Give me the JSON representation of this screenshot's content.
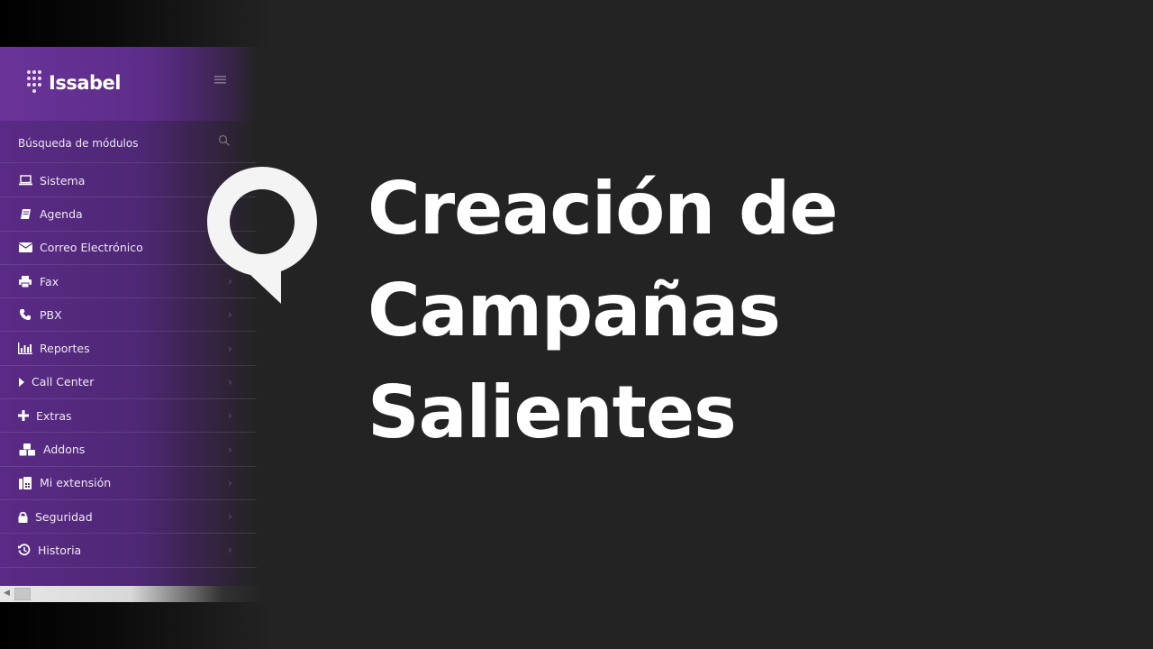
{
  "app": {
    "logo_text": "Issabel",
    "brand_color": "#5d2d8a",
    "accent_color": "#ffffff"
  },
  "sidebar": {
    "search_label": "Búsqueda de módulos",
    "items": [
      {
        "label": "Sistema",
        "icon": "laptop-icon"
      },
      {
        "label": "Agenda",
        "icon": "book-icon"
      },
      {
        "label": "Correo Electrónico",
        "icon": "envelope-icon"
      },
      {
        "label": "Fax",
        "icon": "printer-icon"
      },
      {
        "label": "PBX",
        "icon": "phone-icon"
      },
      {
        "label": "Reportes",
        "icon": "bar-chart-icon"
      },
      {
        "label": "Call Center",
        "icon": "caret-right-icon"
      },
      {
        "label": "Extras",
        "icon": "plus-icon"
      },
      {
        "label": "Addons",
        "icon": "cubes-icon"
      },
      {
        "label": "Mi extensión",
        "icon": "fax-phone-icon"
      },
      {
        "label": "Seguridad",
        "icon": "lock-icon"
      },
      {
        "label": "Historia",
        "icon": "history-icon"
      }
    ]
  },
  "title": {
    "line1": "Creación de",
    "line2": "Campañas",
    "line3": "Salientes"
  }
}
